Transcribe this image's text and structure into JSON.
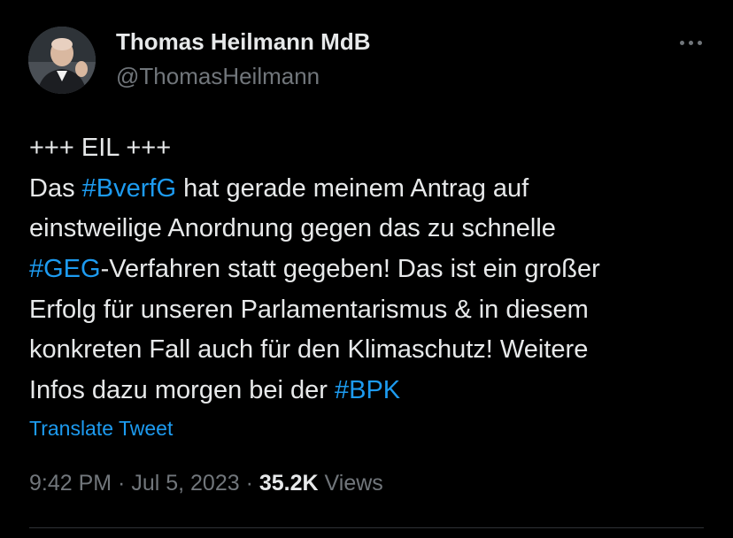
{
  "author": {
    "display_name": "Thomas Heilmann MdB",
    "handle": "@ThomasHeilmann"
  },
  "tweet": {
    "line1": "+++ EIL +++",
    "line2_a": "Das ",
    "line2_tag": "#BverfG",
    "line2_b": " hat gerade meinem Antrag auf",
    "line3": "einstweilige Anordnung gegen das zu schnelle",
    "line4_tag": "#GEG",
    "line4_b": "-Verfahren statt gegeben! Das ist ein großer",
    "line5": "Erfolg für unseren Parlamentarismus & in diesem",
    "line6": "konkreten Fall auch für den Klimaschutz! Weitere",
    "line7_a": "Infos dazu morgen bei der ",
    "line7_tag": "#BPK"
  },
  "translate_label": "Translate Tweet",
  "meta": {
    "time": "9:42 PM",
    "separator1": " · ",
    "date": "Jul 5, 2023",
    "separator2": " · ",
    "views_count": "35.2K",
    "views_label": " Views"
  },
  "icons": {
    "more": "more-horizontal-icon"
  },
  "colors": {
    "background": "#000000",
    "text": "#e7e9ea",
    "secondary": "#71767b",
    "accent": "#1d9bf0"
  }
}
